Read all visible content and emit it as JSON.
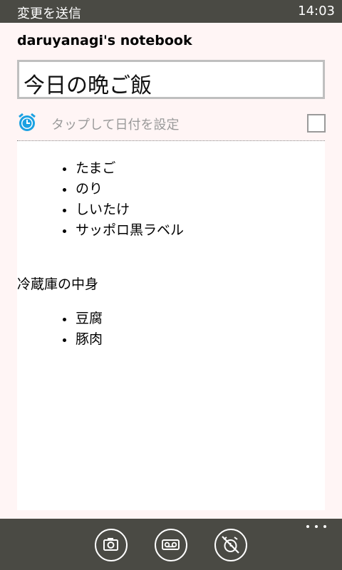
{
  "status": {
    "title": "変更を送信",
    "time": "14:03"
  },
  "notebook": {
    "name": "daruyanagi's notebook"
  },
  "note": {
    "title": "今日の晩ご飯",
    "date_placeholder": "タップして日付を設定",
    "list1": [
      "たまご",
      "のり",
      "しいたけ",
      "サッポロ黒ラベル"
    ],
    "section_heading": "冷蔵庫の中身",
    "list2": [
      "豆腐",
      "豚肉"
    ]
  },
  "app_bar": {
    "buttons": [
      "camera-icon",
      "voice-memo-icon",
      "alarm-off-icon"
    ],
    "more": "ellipsis-icon"
  },
  "colors": {
    "accent": "#1ba1e2",
    "bar": "#4a4a44",
    "page": "#fff5f5"
  }
}
